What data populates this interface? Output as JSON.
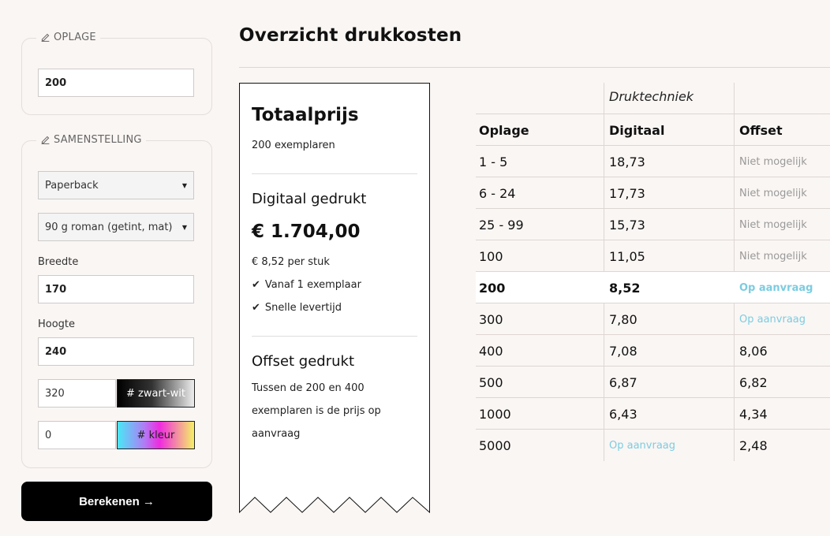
{
  "sidebar": {
    "oplage": {
      "legend": "OPLAGE",
      "value": "200"
    },
    "samenstelling": {
      "legend": "SAMENSTELLING",
      "binding": "Paperback",
      "paper": "90 g roman (getint, mat)",
      "breedte_label": "Breedte",
      "breedte_value": "170",
      "hoogte_label": "Hoogte",
      "hoogte_value": "240",
      "bw_pages": "320",
      "bw_label": "# zwart-wit",
      "color_pages": "0",
      "color_label": "# kleur"
    },
    "calculate_label": "Berekenen →"
  },
  "page_title": "Overzicht drukkosten",
  "receipt": {
    "title": "Totaalprijs",
    "subtitle": "200 exemplaren",
    "digital_heading": "Digitaal gedrukt",
    "digital_price": "€ 1.704,00",
    "digital_per_piece": "€ 8,52 per stuk",
    "checks": [
      "Vanaf 1 exemplaar",
      "Snelle levertijd"
    ],
    "offset_heading": "Offset gedrukt",
    "offset_text": "Tussen de 200 en 400 exemplaren is de prijs op aanvraag"
  },
  "table": {
    "group_header": "Druktechniek",
    "columns": [
      "Oplage",
      "Digitaal",
      "Offset"
    ],
    "rows": [
      [
        "1 - 5",
        "18,73",
        "Niet mogelijk"
      ],
      [
        "6 - 24",
        "17,73",
        "Niet mogelijk"
      ],
      [
        "25 - 99",
        "15,73",
        "Niet mogelijk"
      ],
      [
        "100",
        "11,05",
        "Niet mogelijk"
      ],
      [
        "200",
        "8,52",
        "Op aanvraag"
      ],
      [
        "300",
        "7,80",
        "Op aanvraag"
      ],
      [
        "400",
        "7,08",
        "8,06"
      ],
      [
        "500",
        "6,87",
        "6,82"
      ],
      [
        "1000",
        "6,43",
        "4,34"
      ],
      [
        "5000",
        "Op aanvraag",
        "2,48"
      ]
    ]
  },
  "icons": {
    "legend": "edit-icon",
    "check": "check-icon",
    "caret": "caret-down-icon"
  },
  "colors": {
    "accent_request": "#7ccce0",
    "muted": "#999999",
    "button": "#000000"
  }
}
